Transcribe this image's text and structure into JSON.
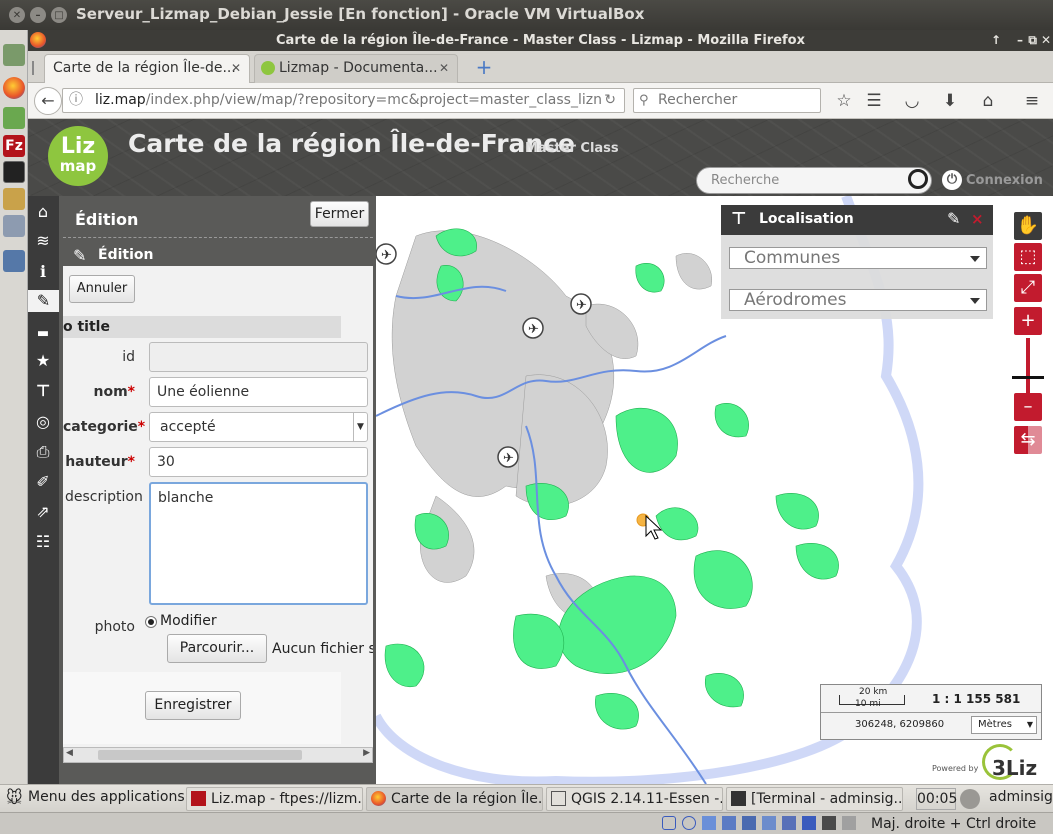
{
  "vbox": {
    "title": "Serveur_Lizmap_Debian_Jessie [En fonction] - Oracle VM VirtualBox"
  },
  "firefox": {
    "window_title": "Carte de la région Île-de-France - Master Class - Lizmap - Mozilla Firefox",
    "tabs": [
      {
        "label": "Carte de la région Île-de...",
        "active": true
      },
      {
        "label": "Lizmap - Documenta...",
        "active": false
      }
    ],
    "url_host": "liz.map",
    "url_path": "/index.php/view/map/?repository=mc&project=master_class_lizn",
    "search_placeholder": "Rechercher"
  },
  "lizmap": {
    "title": "Carte de la région Île-de-France",
    "subtitle": "Master Class",
    "logo_top": "Liz",
    "logo_bottom": "map",
    "search_placeholder": "Recherche",
    "login_label": "Connexion"
  },
  "edition": {
    "header": "Édition",
    "close_label": "Fermer",
    "sub_header": "Édition",
    "cancel_label": "Annuler",
    "form_title": "o title",
    "fields": {
      "id_label": "id",
      "id_value": "",
      "nom_label": "nom",
      "nom_value": "Une éolienne",
      "categorie_label": "categorie",
      "categorie_value": "accepté",
      "hauteur_label": "hauteur",
      "hauteur_value": "30",
      "description_label": "description",
      "description_value": "blanche",
      "photo_label": "photo",
      "photo_radio": "Modifier",
      "browse_label": "Parcourir...",
      "no_file": "Aucun fichier sé"
    },
    "save_label": "Enregistrer"
  },
  "localisation": {
    "title": "Localisation",
    "communes": "Communes",
    "aerodromes": "Aérodromes"
  },
  "scale": {
    "km": "20 km",
    "mi": "10 mi",
    "ratio": "1 : 1 155 581",
    "coords": "306248, 6209860",
    "unit": "Mètres"
  },
  "powered": {
    "label": "Powered by",
    "brand": "3Liz"
  },
  "taskbar": {
    "menu": "Menu des applications",
    "tasks": [
      "Liz.map - ftpes://lizm...",
      "Carte de la région Île...",
      "QGIS 2.14.11-Essen -...",
      "[Terminal - adminsig..."
    ],
    "clock": "00:05",
    "user": "adminsig"
  },
  "status": {
    "host_key": "Maj. droite + Ctrl droite"
  },
  "colors": {
    "lizmap_red": "#c21b2e",
    "forest_green": "#4ef08a",
    "urban_grey": "#d2d2d2"
  }
}
